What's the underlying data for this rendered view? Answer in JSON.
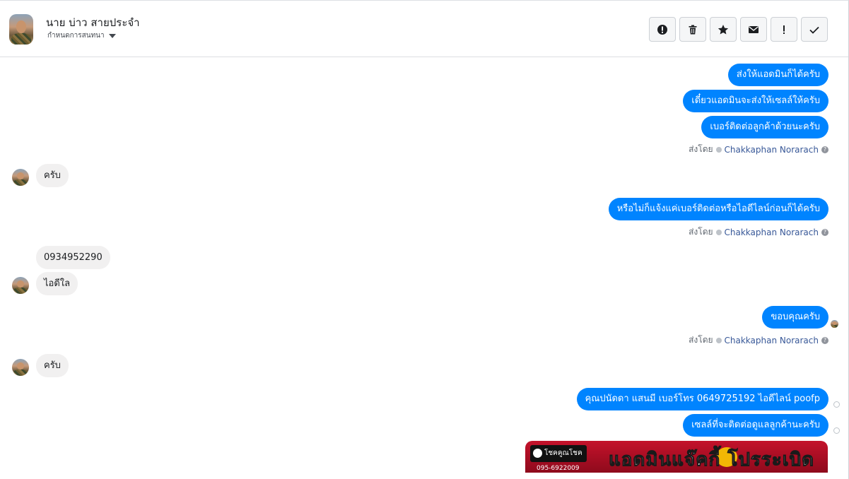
{
  "header": {
    "contact_name": "นาย บ่าว สายประจำ",
    "subtitle": "กำหนดการสนทนา"
  },
  "toolbar": {
    "buttons": [
      {
        "icon": "alert-circle-icon"
      },
      {
        "icon": "trash-icon"
      },
      {
        "icon": "star-icon"
      },
      {
        "icon": "envelope-icon"
      },
      {
        "icon": "exclamation-icon"
      },
      {
        "icon": "checkmark-icon"
      }
    ]
  },
  "messages": {
    "m1": "ส่งให้แอดมินก็ได้ครับ",
    "m2": "เดี๋ยวแอดมินจะส่งให้เซลล์ให้ครับ",
    "m3": "เบอร์ติดต่อลูกค้าด้วยนะครับ",
    "m4": "ครับ",
    "m5": "หรือไม่ก็แจ้งแค่เบอร์ติดต่อหรือไอดีไลน์ก่อนก็ได้ครับ",
    "m6": "0934952290",
    "m7": "ไอดีใล",
    "m8": "ขอบคุณครับ",
    "m9": "ครับ",
    "m10": "คุณปนัดดา แสนมี   เบอร์โทร 0649725192  ไอดีไลน์ poofp",
    "m11": "เซลล์ที่จะติดต่อดูแลลูกค้านะครับ"
  },
  "sent_by": {
    "prefix": "ส่งโดย",
    "agent_name": "Chakkaphan Norarach"
  },
  "banner": {
    "brand": "โชคคูณโชค",
    "phone": "095-6922009",
    "headline": "แอดมินแจ๊คกี้ โปรระเบิด"
  },
  "colors": {
    "outgoing_bubble": "#0084ff",
    "incoming_bubble": "#f1f0f0",
    "agent_link": "#385898"
  }
}
